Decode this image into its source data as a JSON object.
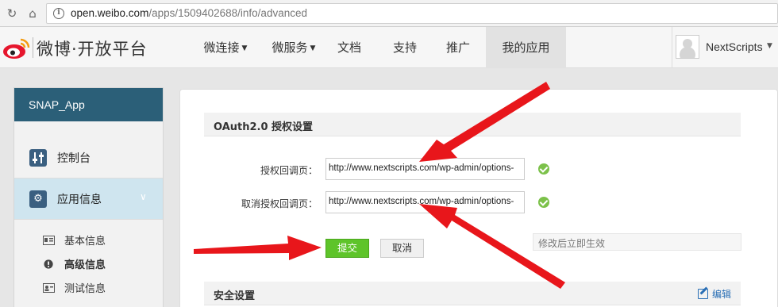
{
  "browser": {
    "url_host": "open.weibo.com",
    "url_path": "/apps/1509402688/info/advanced"
  },
  "header": {
    "logo_text": "微博·开放平台",
    "nav": [
      {
        "label": "微连接",
        "has_caret": true
      },
      {
        "label": "微服务",
        "has_caret": true
      },
      {
        "label": "文档",
        "has_caret": false
      },
      {
        "label": "支持",
        "has_caret": false
      },
      {
        "label": "推广",
        "has_caret": false
      },
      {
        "label": "我的应用",
        "has_caret": false,
        "active": true
      }
    ],
    "user_name": "NextScripts"
  },
  "sidebar": {
    "app_title": "SNAP_App",
    "items": [
      {
        "label": "控制台",
        "icon": "sliders-icon"
      },
      {
        "label": "应用信息",
        "icon": "gear-icon",
        "active": true
      }
    ],
    "sub_items": [
      {
        "label": "基本信息",
        "icon": "id-card-icon"
      },
      {
        "label": "高级信息",
        "icon": "exclamation-icon",
        "bold": true
      },
      {
        "label": "测试信息",
        "icon": "user-card-icon"
      }
    ]
  },
  "main": {
    "oauth_title": "OAuth2.0 授权设置",
    "callback_label": "授权回调页：",
    "callback_value": "http://www.nextscripts.com/wp-admin/options-",
    "cancel_callback_label": "取消授权回调页：",
    "cancel_callback_value": "http://www.nextscripts.com/wp-admin/options-",
    "submit_label": "提交",
    "cancel_label": "取消",
    "hint": "修改后立即生效",
    "security_title": "安全设置",
    "edit_label": "编辑"
  },
  "colors": {
    "sidebar_header": "#2b5f78",
    "active_sidebar": "#cfe5ef",
    "submit_green": "#5ec42a",
    "check_green": "#7cc14a",
    "arrow_red": "#e8161b",
    "link_blue": "#2a6fb5"
  }
}
